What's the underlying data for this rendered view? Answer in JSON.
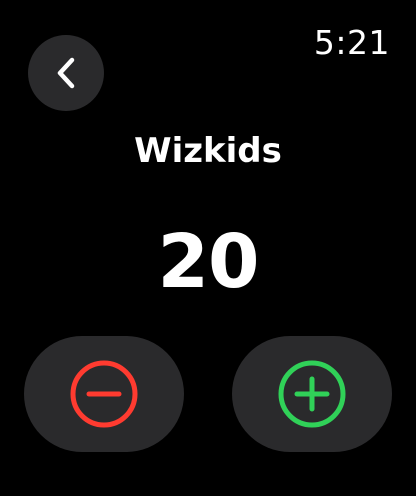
{
  "status_bar": {
    "time": "5:21"
  },
  "header": {
    "back_icon": "chevron-left-icon"
  },
  "counter": {
    "title": "Wizkids",
    "value": "20"
  },
  "controls": {
    "decrement_icon": "minus-circle-icon",
    "increment_icon": "plus-circle-icon"
  },
  "colors": {
    "background": "#000000",
    "button_bg": "#2a2a2c",
    "decrement": "#ff3b30",
    "increment": "#30d158",
    "text": "#ffffff"
  }
}
